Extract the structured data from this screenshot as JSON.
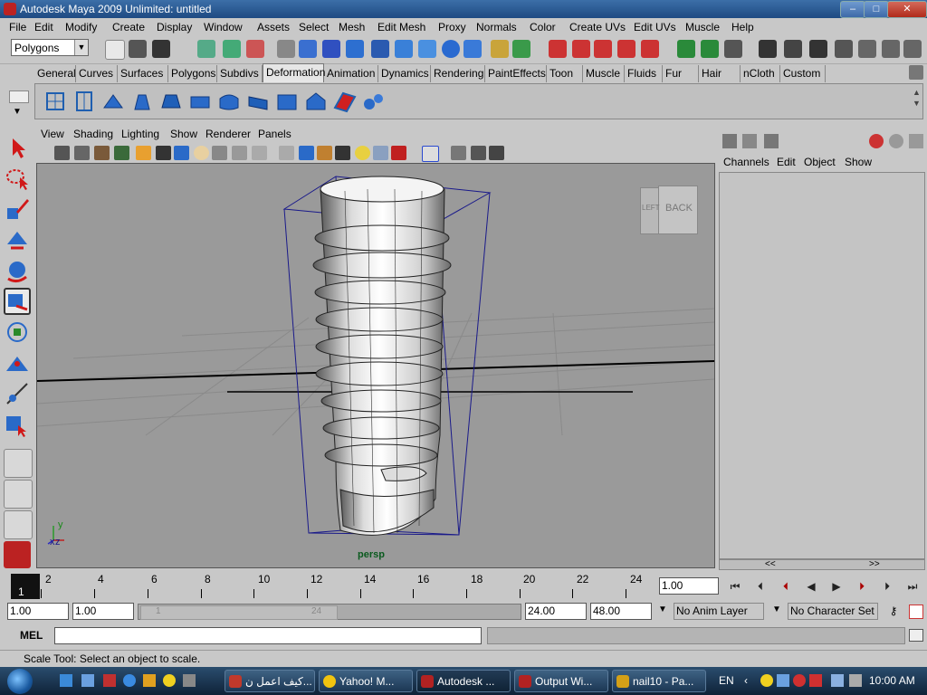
{
  "window": {
    "title": "Autodesk Maya 2009 Unlimited: untitled",
    "min_label": "–",
    "max_label": "□",
    "close_label": "✕"
  },
  "menubar": [
    "File",
    "Edit",
    "Modify",
    "Create",
    "Display",
    "Window",
    "Assets",
    "Select",
    "Mesh",
    "Edit Mesh",
    "Proxy",
    "Normals",
    "Color",
    "Create UVs",
    "Edit UVs",
    "Muscle",
    "Help"
  ],
  "mode_selector": {
    "value": "Polygons"
  },
  "shelf": {
    "tabs": [
      "General",
      "Curves",
      "Surfaces",
      "Polygons",
      "Subdivs",
      "Deformation",
      "Animation",
      "Dynamics",
      "Rendering",
      "PaintEffects",
      "Toon",
      "Muscle",
      "Fluids",
      "Fur",
      "Hair",
      "nCloth",
      "Custom"
    ],
    "active_tab": "Deformation"
  },
  "panel": {
    "menu": [
      "View",
      "Shading",
      "Lighting",
      "Show",
      "Renderer",
      "Panels"
    ],
    "camera_label": "persp"
  },
  "viewcube": {
    "face_back": "BACK",
    "face_left": "LEFT"
  },
  "axis": {
    "x": "x",
    "y": "y",
    "z": "z"
  },
  "channel_box": {
    "menu": [
      "Channels",
      "Edit",
      "Object",
      "Show"
    ],
    "scroll_left": "<<",
    "scroll_right": ">>"
  },
  "time_slider": {
    "current_frame": "1",
    "ticks": [
      "2",
      "4",
      "6",
      "8",
      "10",
      "12",
      "14",
      "16",
      "18",
      "20",
      "22",
      "24"
    ],
    "current_time_field": "1.00"
  },
  "range_slider": {
    "start_time": "1.00",
    "playback_start": "1.00",
    "playback_end": "24.00",
    "end_time": "48.00",
    "range_start_mark": "1",
    "range_end_mark": "24",
    "anim_layer": "No Anim Layer",
    "character_set": "No Character Set"
  },
  "command_line": {
    "label": "MEL",
    "value": ""
  },
  "help_line": "Scale Tool: Select an object to scale.",
  "taskbar": {
    "buttons": [
      {
        "label": "كيف اعمل ن...",
        "icon_color": "#c0392b"
      },
      {
        "label": "Yahoo! M...",
        "icon_color": "#f1c40f"
      },
      {
        "label": "Autodesk ...",
        "icon_color": "#b22222"
      },
      {
        "label": "Output Wi...",
        "icon_color": "#b22222"
      },
      {
        "label": "nail10 - Pa...",
        "icon_color": "#d4a017"
      }
    ],
    "language": "EN",
    "clock": "10:00 AM"
  },
  "colors": {
    "title_bar": "#1e4a82",
    "viewport_bg": "#9a9a9a",
    "wireframe": "#1a1a8a",
    "active_frame": "#111111"
  }
}
